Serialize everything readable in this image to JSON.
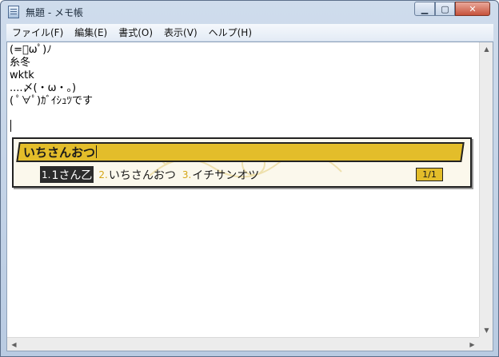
{
  "window": {
    "title": "無題 - メモ帳",
    "minimize_glyph": "▁",
    "maximize_glyph": "▢",
    "close_glyph": "✕"
  },
  "menu": {
    "items": [
      {
        "label": "ファイル(F)"
      },
      {
        "label": "編集(E)"
      },
      {
        "label": "書式(O)"
      },
      {
        "label": "表示(V)"
      },
      {
        "label": "ヘルプ(H)"
      }
    ]
  },
  "editor": {
    "lines": [
      "(=ﾟωﾟ)ﾉ",
      "糸冬",
      "wktk",
      "....〆(・ω・。)",
      "( ﾟ∀ﾟ)ｶﾞｲｼｭﾂです",
      ""
    ]
  },
  "ime": {
    "input": "いちさんおつ",
    "candidates": [
      {
        "num": "1.",
        "text": "1さん乙"
      },
      {
        "num": "2.",
        "text": "いちさんおつ"
      },
      {
        "num": "3.",
        "text": "イチサンオツ"
      }
    ],
    "selected_index": 0,
    "page": "1/1",
    "accent_color": "#e3bd2a"
  },
  "scrollbars": {
    "up": "▲",
    "down": "▼",
    "left": "◀",
    "right": "▶"
  }
}
